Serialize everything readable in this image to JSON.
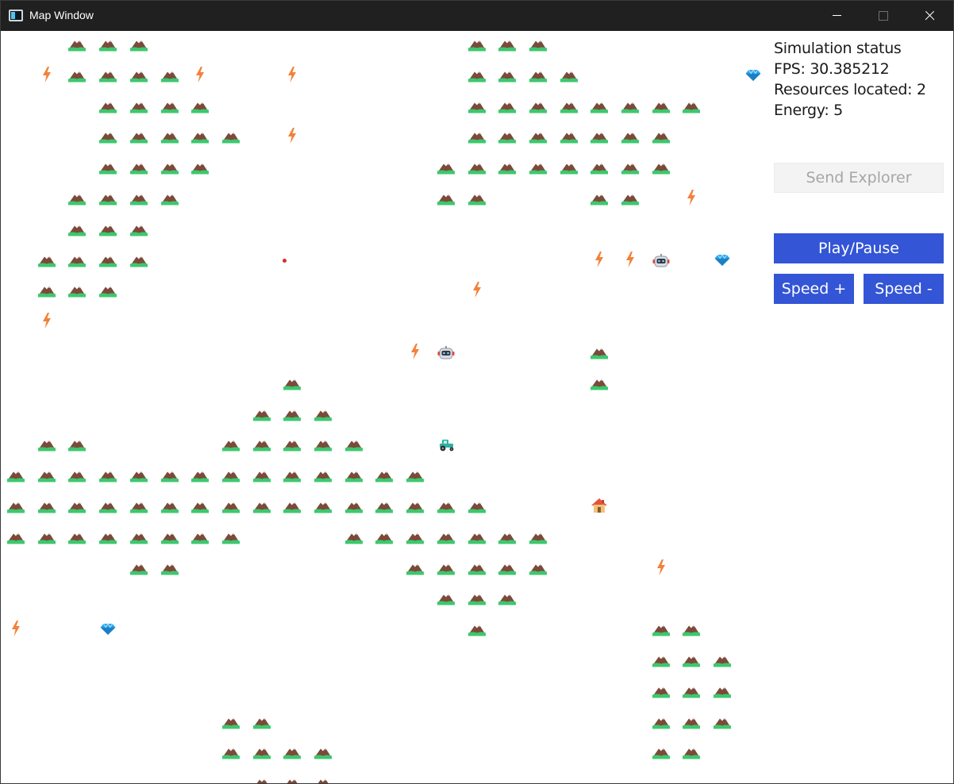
{
  "window": {
    "title": "Map Window"
  },
  "status": {
    "heading": "Simulation status",
    "fps": "FPS: 30.385212",
    "resources": "Resources located: 2",
    "energy": "Energy: 5"
  },
  "buttons": {
    "send_explorer": "Send Explorer",
    "play_pause": "Play/Pause",
    "speed_up": "Speed +",
    "speed_down": "Speed -"
  },
  "colors": {
    "titlebar": "#202020",
    "button": "#3355d6",
    "button_disabled": "#f3f3f3",
    "mountain": "#7b4a3a",
    "grass": "#3cc86e",
    "energy": "#f2813a",
    "gem": "#29a8f0"
  },
  "map": {
    "tile_icons": [
      "mountain-icon",
      "energy-bolt-icon",
      "gem-icon",
      "robot-icon",
      "tractor-icon",
      "house-icon",
      "marker-dot"
    ],
    "mountain_rows": [
      "  xxx          xxx     ",
      "  xxxx         xxxx    ",
      "   xxxx        xxxxxxxx",
      "   xxxxx       xxxxxxx ",
      "   xxxx       xxxxxxxx ",
      "  xxxx        xx   xx  ",
      "  xxx                  ",
      " xxxx                  ",
      " xxx                   ",
      "                       ",
      "                   x   ",
      "         x         x   ",
      "        xxx            ",
      " xx    xxxxx           ",
      "xxxxxxxxxxxxxx         ",
      "xxxxxxxxxxxxxxxx       ",
      "xxxxxxxx   xxxxxxx     ",
      "    xx       xxxxx     ",
      "              xxx      ",
      "               x     xx",
      "                     xxx",
      "                     xxx",
      "       xx            xxx",
      "       xxxx          xx ",
      "        xxx             "
    ],
    "energy": [
      [
        1,
        1
      ],
      [
        1,
        6
      ],
      [
        1,
        9
      ],
      [
        3,
        9
      ],
      [
        5,
        22
      ],
      [
        7,
        19
      ],
      [
        7,
        20
      ],
      [
        8,
        15
      ],
      [
        9,
        1
      ],
      [
        10,
        13
      ],
      [
        17,
        21
      ],
      [
        19,
        0
      ]
    ],
    "gems": [
      [
        1,
        24
      ],
      [
        7,
        23
      ],
      [
        19,
        3
      ]
    ],
    "robots": [
      [
        7,
        21
      ],
      [
        10,
        14
      ]
    ],
    "tractor": [
      13,
      14
    ],
    "house": [
      15,
      19
    ]
  }
}
